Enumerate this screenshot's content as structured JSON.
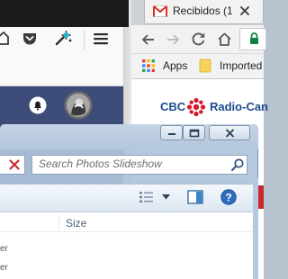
{
  "firefox": {
    "toolbar_icons": [
      "home-icon",
      "pocket-icon",
      "extensions-icon",
      "menu-icon"
    ],
    "header_icons": [
      "notifications-icon",
      "avatar"
    ]
  },
  "chrome": {
    "tab_title": "Recibidos (1",
    "tab_icon": "gmail-icon",
    "nav_icons": [
      "back-icon",
      "forward-icon",
      "reload-icon",
      "home-icon"
    ],
    "bookmarks": {
      "apps_label": "Apps",
      "imported_label": "Imported"
    },
    "page": {
      "cbc_label": "CBC",
      "radio_canada_label": "Radio-Can"
    }
  },
  "photos_window": {
    "search_placeholder": "Search Photos Slideshow",
    "column_size": "Size",
    "row_fragments": [
      "er",
      "er"
    ],
    "colors": {
      "glass": "#b3c6dd",
      "cbc_red": "#d7192d",
      "cbc_blue": "#1d4a8f"
    }
  }
}
